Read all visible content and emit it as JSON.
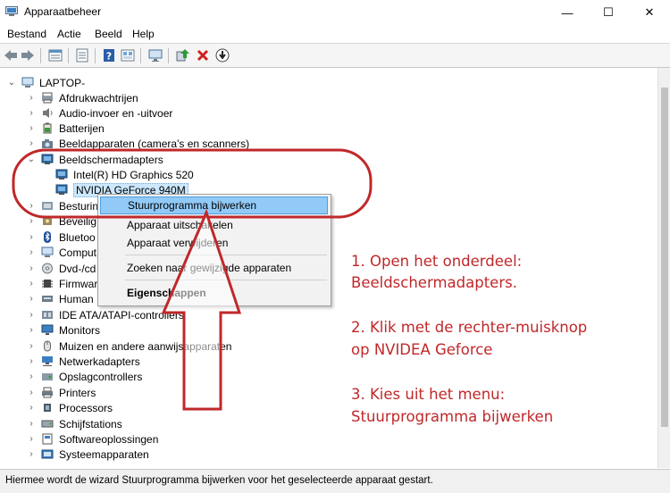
{
  "window": {
    "title": "Apparaatbeheer",
    "minimize_glyph": "—",
    "maximize_glyph": "☐",
    "close_glyph": "✕"
  },
  "menu": [
    "Bestand",
    "Actie",
    "Beeld",
    "Help"
  ],
  "toolbar": [
    "back-icon",
    "forward-icon",
    "properties-icon",
    "list-icon",
    "help-icon",
    "view-icon",
    "monitor-icon",
    "update-driver-icon",
    "uninstall-icon",
    "download-icon"
  ],
  "tree": {
    "root": "LAPTOP-",
    "categories": [
      "Afdrukwachtrijen",
      "Audio-invoer en -uitvoer",
      "Batterijen",
      "Beeldapparaten (camera's en scanners)",
      "Beeldschermadapters",
      "Intel(R) HD Graphics 520",
      "NVIDIA GeForce 940M",
      "Besturin",
      "Beveilig",
      "Bluetoo",
      "Comput",
      "Dvd-/cd",
      "Firmwar",
      "Human",
      "IDE ATA/ATAPI-controllers",
      "Monitors",
      "Muizen en andere aanwijsapparaten",
      "Netwerkadapters",
      "Opslagcontrollers",
      "Printers",
      "Processors",
      "Schijfstations",
      "Softwareoplossingen",
      "Systeemapparaten"
    ]
  },
  "context_menu": {
    "items": [
      "Stuurprogramma bijwerken",
      "Apparaat uitschakelen",
      "Apparaat verwijderen",
      "Zoeken naar gewijzigde apparaten",
      "Eigenschappen"
    ]
  },
  "status": "Hiermee wordt de wizard Stuurprogramma bijwerken voor het geselecteerde apparaat gestart.",
  "instructions": [
    "1. Open het onderdeel:",
    "Beeldschermadapters.",
    "2. Klik met de rechter-muisknop",
    "op NVIDEA Geforce",
    "3. Kies uit het menu:",
    "Stuurprogramma bijwerken"
  ],
  "colors": {
    "annotation_red": "#c0282a",
    "highlight": "#91c9f7",
    "selection": "#cce8ff"
  }
}
